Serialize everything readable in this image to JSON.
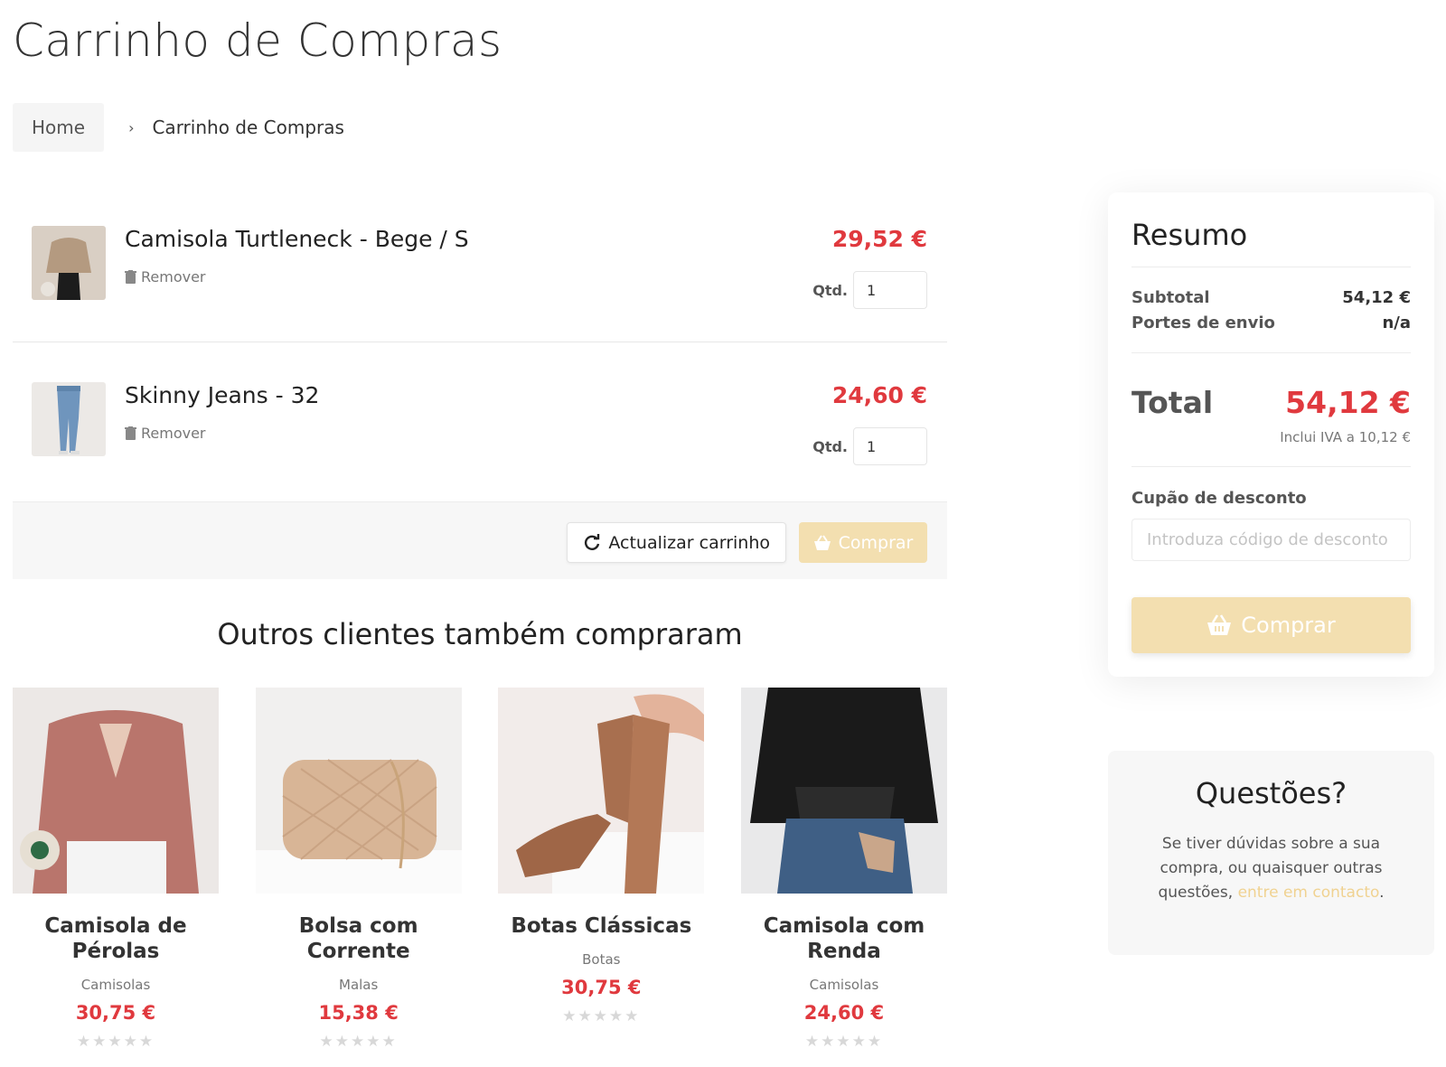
{
  "page": {
    "title": "Carrinho de Compras"
  },
  "breadcrumb": {
    "home": "Home",
    "separator": "›",
    "current": "Carrinho de Compras"
  },
  "cart": {
    "items": [
      {
        "name": "Camisola Turtleneck - Bege / S",
        "remove_label": "Remover",
        "price": "29,52 €",
        "qty_label": "Qtd.",
        "qty": "1",
        "thumb_icon": "beige-sweater-photo"
      },
      {
        "name": "Skinny Jeans - 32",
        "remove_label": "Remover",
        "price": "24,60 €",
        "qty_label": "Qtd.",
        "qty": "1",
        "thumb_icon": "jeans-photo"
      }
    ],
    "update_label": "Actualizar carrinho",
    "buy_label": "Comprar"
  },
  "also_bought": {
    "title": "Outros clientes também compraram",
    "products": [
      {
        "name": "Camisola de Pérolas",
        "category": "Camisolas",
        "price": "30,75 €",
        "stars": "★★★★★"
      },
      {
        "name": "Bolsa com Corrente",
        "category": "Malas",
        "price": "15,38 €",
        "stars": "★★★★★"
      },
      {
        "name": "Botas Clássicas",
        "category": "Botas",
        "price": "30,75 €",
        "stars": "★★★★★"
      },
      {
        "name": "Camisola com Renda",
        "category": "Camisolas",
        "price": "24,60 €",
        "stars": "★★★★★"
      }
    ]
  },
  "summary": {
    "title": "Resumo",
    "subtotal_label": "Subtotal",
    "subtotal_value": "54,12 €",
    "shipping_label": "Portes de envio",
    "shipping_value": "n/a",
    "total_label": "Total",
    "total_value": "54,12 €",
    "vat_note": "Inclui IVA a 10,12 €",
    "coupon_label": "Cupão de desconto",
    "coupon_placeholder": "Introduza código de desconto",
    "buy_label": "Comprar"
  },
  "questions": {
    "title": "Questões?",
    "text": "Se tiver dúvidas sobre a sua compra, ou quaisquer outras questões, ",
    "link": "entre em contacto",
    "end": "."
  },
  "colors": {
    "price_red": "#e0393e",
    "buy_button": "#f3dfb0",
    "link": "#f0d291"
  }
}
